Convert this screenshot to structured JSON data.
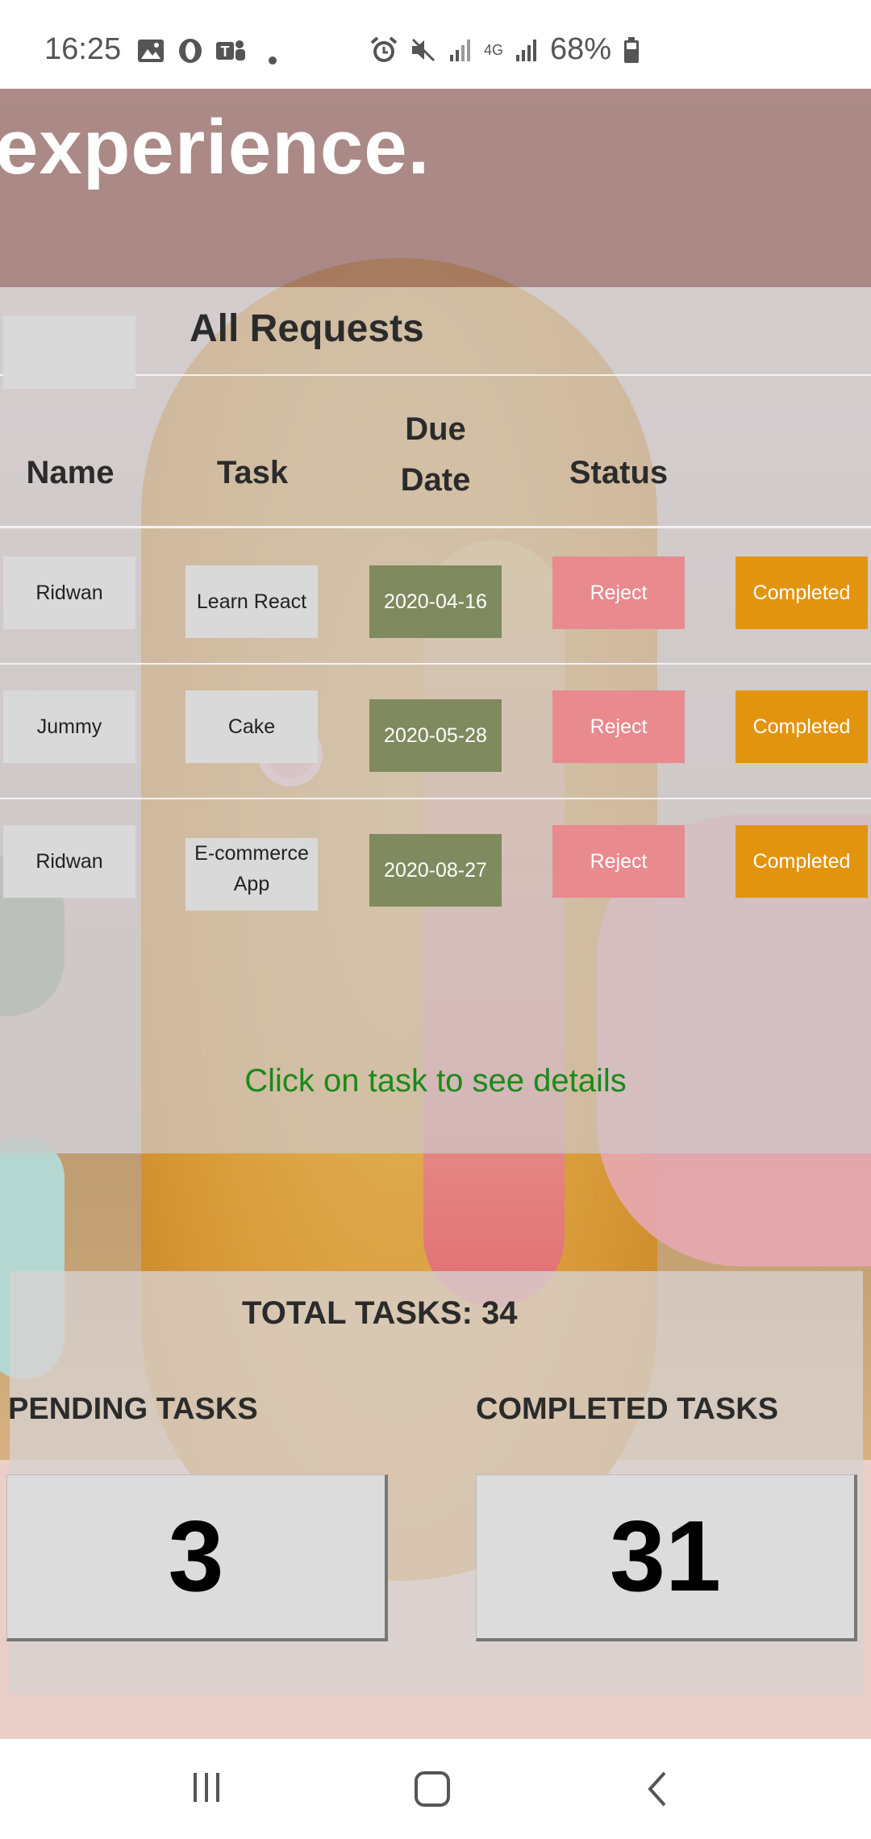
{
  "status_bar": {
    "time": "16:25",
    "network": "4G",
    "battery": "68%"
  },
  "hero": {
    "text": "experience."
  },
  "requests": {
    "title": "All Requests",
    "headers": {
      "name": "Name",
      "task": "Task",
      "due_date": "Due Date",
      "status": "Status"
    },
    "rows": [
      {
        "name": "Ridwan",
        "task": "Learn React",
        "due": "2020-04-16",
        "reject": "Reject",
        "complete": "Completed"
      },
      {
        "name": "Jummy",
        "task": "Cake",
        "due": "2020-05-28",
        "reject": "Reject",
        "complete": "Completed"
      },
      {
        "name": "Ridwan",
        "task": "E-commerce App",
        "due": "2020-08-27",
        "reject": "Reject",
        "complete": "Completed"
      }
    ],
    "hint": "Click on task to see details"
  },
  "stats": {
    "total": "TOTAL TASKS: 34",
    "pending_label": "PENDING TASKS",
    "pending_value": "3",
    "completed_label": "COMPLETED TASKS",
    "completed_value": "31"
  },
  "icons": [
    "gallery-icon",
    "opera-icon",
    "teams-icon",
    "alarm-icon",
    "mute-icon",
    "signal-icon",
    "battery-icon",
    "recents-icon",
    "home-icon",
    "back-icon"
  ],
  "colors": {
    "date_bg": "#7f8a5f",
    "reject_bg": "#e88a8e",
    "complete_bg": "#e3940f",
    "hint": "#1a8a1a"
  }
}
